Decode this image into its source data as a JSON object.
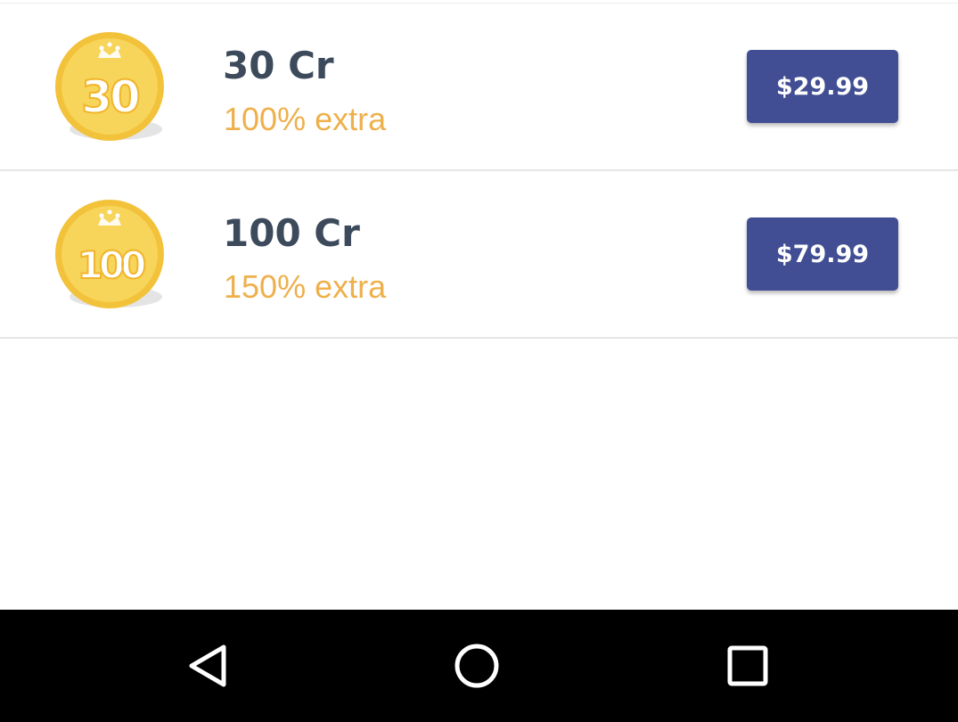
{
  "packages": [
    {
      "coin_label": "30",
      "amount": "30 Cr",
      "extra": "100% extra",
      "price": "$29.99",
      "icon": "coin-30-icon"
    },
    {
      "coin_label": "100",
      "amount": "100 Cr",
      "extra": "150% extra",
      "price": "$79.99",
      "icon": "coin-100-icon"
    }
  ],
  "colors": {
    "amount_text": "#3c4a5c",
    "extra_text": "#eeb04b",
    "button_bg": "#414e93",
    "coin_gold": "#f6c633",
    "navbar_bg": "#000000"
  },
  "navigation_bar": {
    "back_icon": "back-triangle-icon",
    "home_icon": "home-circle-icon",
    "recents_icon": "recents-square-icon"
  }
}
